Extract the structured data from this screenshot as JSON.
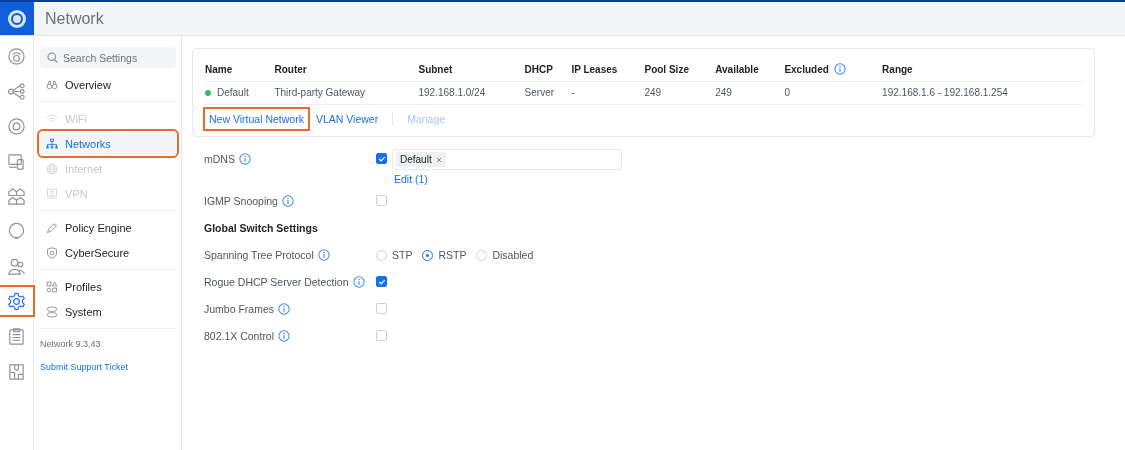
{
  "header": {
    "title": "Network"
  },
  "rail": [
    {
      "kind": "dashboard",
      "selected": false,
      "highlighted": false
    },
    {
      "kind": "topology",
      "selected": false,
      "highlighted": false
    },
    {
      "kind": "device",
      "selected": false,
      "highlighted": false
    },
    {
      "kind": "clients",
      "selected": false,
      "highlighted": false
    },
    {
      "kind": "grid",
      "selected": false,
      "highlighted": false
    },
    {
      "kind": "insights",
      "selected": false,
      "highlighted": false
    },
    {
      "kind": "users",
      "selected": false,
      "highlighted": false
    },
    {
      "kind": "settings",
      "selected": true,
      "highlighted": true
    },
    {
      "kind": "list",
      "selected": false,
      "highlighted": false
    },
    {
      "kind": "map",
      "selected": false,
      "highlighted": false
    }
  ],
  "sidebar": {
    "search": {
      "placeholder": "Search Settings"
    },
    "groups": [
      [
        {
          "label": "Overview",
          "kind": "binoculars",
          "disabled": false,
          "selected": false,
          "highlighted": false
        }
      ],
      [
        {
          "label": "WiFi",
          "kind": "wifi",
          "disabled": true,
          "selected": false,
          "highlighted": false
        },
        {
          "label": "Networks",
          "kind": "network",
          "disabled": false,
          "selected": true,
          "highlighted": true
        },
        {
          "label": "Internet",
          "kind": "globe",
          "disabled": true,
          "selected": false,
          "highlighted": false
        },
        {
          "label": "VPN",
          "kind": "vpn",
          "disabled": true,
          "selected": false,
          "highlighted": false
        }
      ],
      [
        {
          "label": "Policy Engine",
          "kind": "policy",
          "disabled": false,
          "selected": false,
          "highlighted": false
        },
        {
          "label": "CyberSecure",
          "kind": "shield",
          "disabled": false,
          "selected": false,
          "highlighted": false
        }
      ],
      [
        {
          "label": "Profiles",
          "kind": "profiles",
          "disabled": false,
          "selected": false,
          "highlighted": false
        },
        {
          "label": "System",
          "kind": "system",
          "disabled": false,
          "selected": false,
          "highlighted": false
        }
      ]
    ],
    "version": "Network 9.3.43",
    "support_link": "Submit Support Ticket"
  },
  "table": {
    "columns": [
      {
        "label": "Name",
        "info": false
      },
      {
        "label": "Router",
        "info": false
      },
      {
        "label": "Subnet",
        "info": false
      },
      {
        "label": "DHCP",
        "info": false
      },
      {
        "label": "IP Leases",
        "info": false
      },
      {
        "label": "Pool Size",
        "info": false
      },
      {
        "label": "Available",
        "info": false
      },
      {
        "label": "Excluded",
        "info": true
      },
      {
        "label": "Range",
        "info": false
      }
    ],
    "rows": [
      {
        "color": "#2fc25b",
        "cells": [
          "Default",
          "Third-party Gateway",
          "192.168.1.0/24",
          "Server",
          "-",
          "249",
          "249",
          "0",
          "192.168.1.6 - 192.168.1.254"
        ]
      }
    ]
  },
  "actions": [
    {
      "label": "New Virtual Network",
      "disabled": false,
      "highlighted": true
    },
    {
      "label": "VLAN Viewer",
      "disabled": false,
      "highlighted": false
    },
    {
      "label": "Manage",
      "disabled": true,
      "highlighted": false
    }
  ],
  "settings": [
    {
      "kind": "checkbox-tags",
      "label": "mDNS",
      "info": true,
      "checked": true,
      "tags": [
        "Default"
      ],
      "link": "Edit (1)"
    },
    {
      "kind": "checkbox",
      "label": "IGMP Snooping",
      "info": true,
      "checked": false
    },
    {
      "kind": "heading",
      "label": "Global Switch Settings"
    },
    {
      "kind": "radio",
      "label": "Spanning Tree Protocol",
      "info": true,
      "options": [
        {
          "label": "STP",
          "selected": false
        },
        {
          "label": "RSTP",
          "selected": true
        },
        {
          "label": "Disabled",
          "selected": false
        }
      ]
    },
    {
      "kind": "checkbox",
      "label": "Rogue DHCP Server Detection",
      "info": true,
      "checked": true
    },
    {
      "kind": "checkbox",
      "label": "Jumbo Frames",
      "info": true,
      "checked": false
    },
    {
      "kind": "checkbox",
      "label": "802.1X Control",
      "info": true,
      "checked": false
    }
  ]
}
